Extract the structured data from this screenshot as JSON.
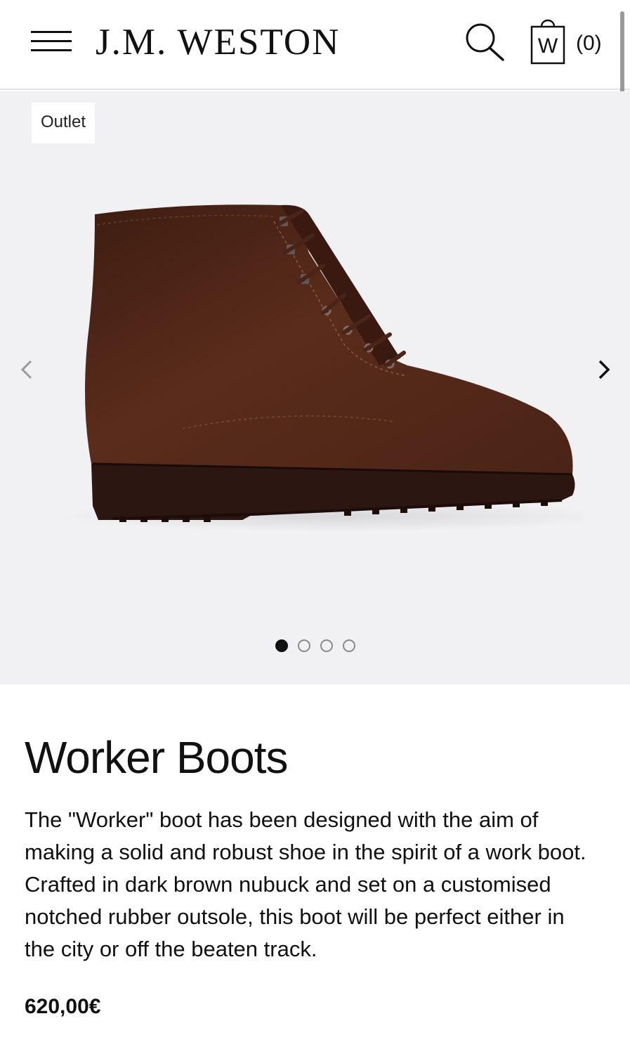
{
  "header": {
    "brand": "J.M. WESTON",
    "cart_count": "(0)",
    "bag_letter": "W",
    "icons": [
      "hamburger-menu-icon",
      "search-icon",
      "shopping-bag-icon"
    ]
  },
  "gallery": {
    "badge": "Outlet",
    "slide_count": 4,
    "active_slide": 1,
    "background_color": "#f1f1f3",
    "product_color": "#4e2519"
  },
  "product": {
    "title": "Worker Boots",
    "description": "The \"Worker\" boot has been designed with the aim of making a solid and robust shoe in the spirit of a work boot. Crafted in dark brown nubuck and set on a customised notched rubber outsole, this boot will be perfect either in the city or off the beaten track.",
    "price": "620,00€"
  }
}
